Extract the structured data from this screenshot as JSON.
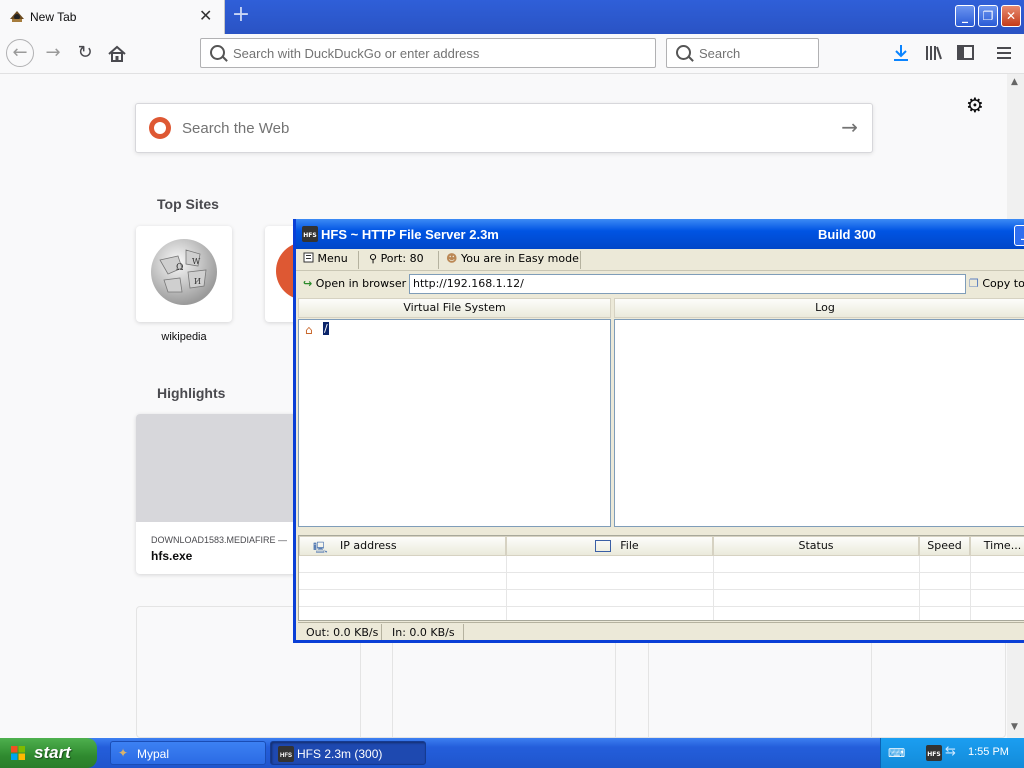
{
  "firefox": {
    "tab_title": "New Tab",
    "url_placeholder": "Search with DuckDuckGo or enter address",
    "search_placeholder": "Search"
  },
  "newtab": {
    "web_search_placeholder": "Search the Web",
    "top_sites_title": "Top Sites",
    "top_sites": [
      {
        "label": "wikipedia"
      }
    ],
    "highlights_title": "Highlights",
    "highlights": [
      {
        "source": "DOWNLOAD1583.MEDIAFIRE —",
        "name": "hfs.exe"
      }
    ]
  },
  "hfs": {
    "title": "HFS ~ HTTP File Server 2.3m",
    "build": "Build 300",
    "toolbar": {
      "menu": "Menu",
      "port": "Port: 80",
      "mode": "You are in Easy mode"
    },
    "open_in_browser": "Open in browser",
    "url": "http://192.168.1.12/",
    "copy_label": "Copy to",
    "vfs_header": "Virtual File System",
    "vfs_root": "/",
    "log_header": "Log",
    "connections_columns": [
      "IP address",
      "File",
      "Status",
      "Speed",
      "Time..."
    ],
    "status_out": "Out: 0.0 KB/s",
    "status_in": "In: 0.0 KB/s"
  },
  "taskbar": {
    "start_label": "start",
    "tasks": [
      {
        "label": "Mypal",
        "active": false
      },
      {
        "label": "HFS 2.3m (300)",
        "active": true
      }
    ],
    "clock": "1:55 PM"
  },
  "colors": {
    "xp_title_blue": "#0054e3",
    "firefox_tabstrip": "#2f5fd8",
    "start_green": "#2f8a2f",
    "ddg_orange": "#de5833"
  }
}
